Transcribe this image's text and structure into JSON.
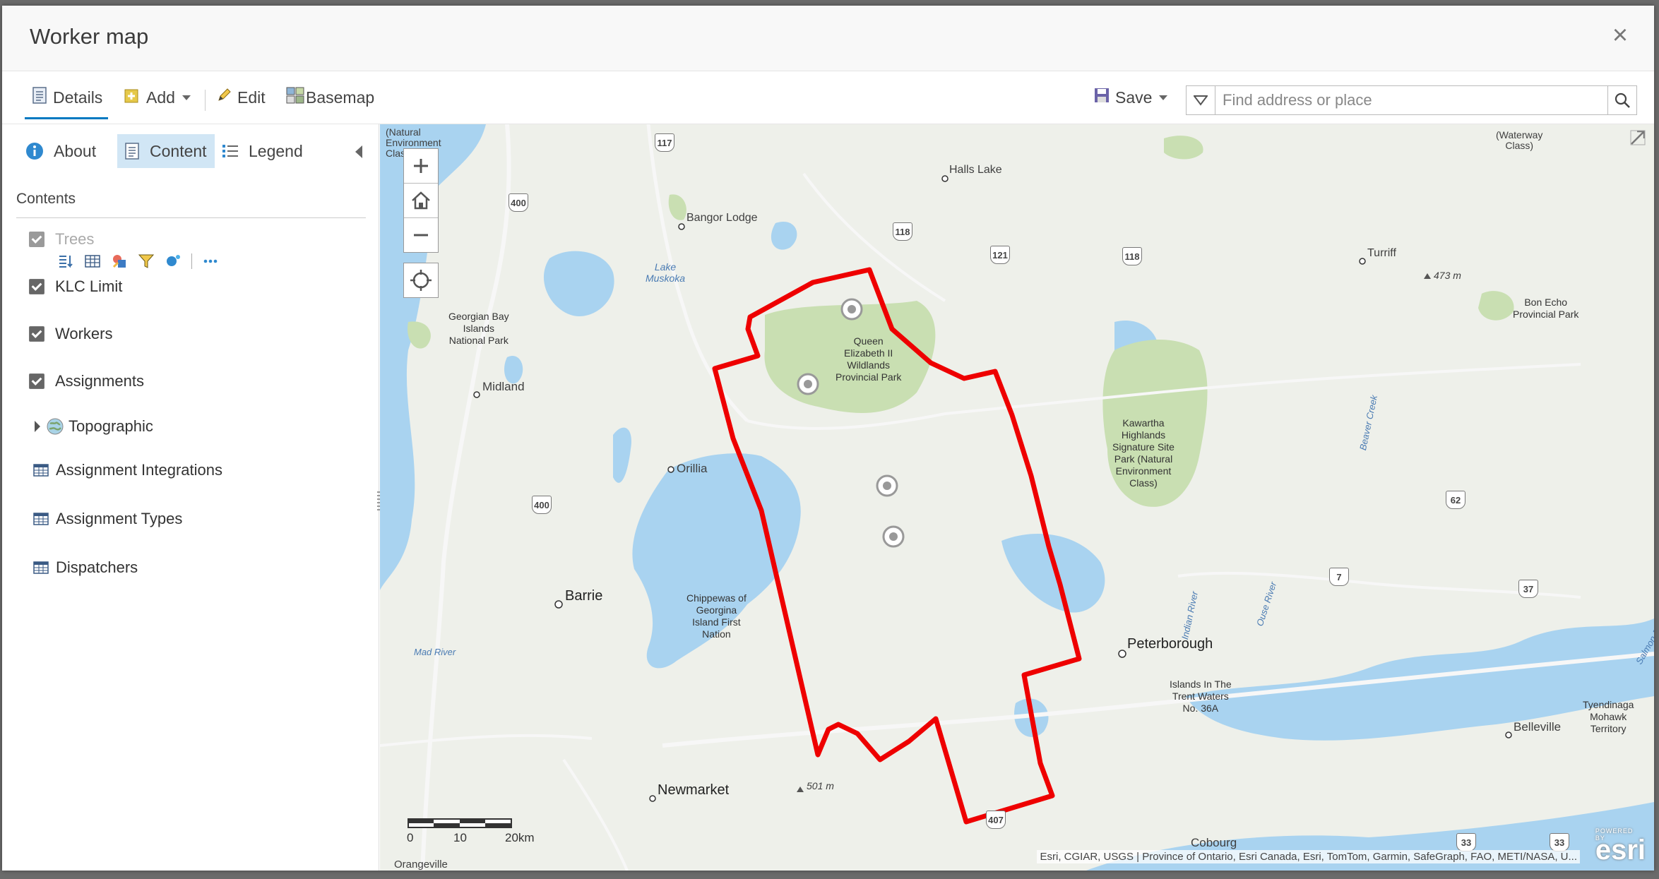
{
  "window": {
    "title": "Worker map",
    "close_icon": "close-icon"
  },
  "toolbar": {
    "details": "Details",
    "add": "Add",
    "edit": "Edit",
    "basemap": "Basemap",
    "save": "Save",
    "search_placeholder": "Find address or place"
  },
  "sidebar": {
    "tabs": {
      "about": "About",
      "content": "Content",
      "legend": "Legend"
    },
    "contents_heading": "Contents",
    "layers": {
      "trees": "Trees",
      "klc": "KLC Limit",
      "workers": "Workers",
      "assignments": "Assignments",
      "topographic": "Topographic",
      "assignment_integrations": "Assignment Integrations",
      "assignment_types": "Assignment Types",
      "dispatchers": "Dispatchers"
    }
  },
  "map": {
    "labels": {
      "natural_env": "(Natural\nEnvironment\nClass)",
      "waterway": "(Waterway\nClass)",
      "halls_lake": "Halls Lake",
      "bangor_lodge": "Bangor Lodge",
      "turriff": "Turriff",
      "elev_473": "473 m",
      "bon_echo": "Bon Echo\nProvincial Park",
      "lake_muskoka": "Lake\nMuskoka",
      "georgian_bay": "Georgian Bay\nIslands\nNational Park",
      "queen_elizabeth": "Queen\nElizabeth II\nWildlands\nProvincial Park",
      "midland": "Midland",
      "kawartha": "Kawartha\nHighlands\nSignature Site\nPark (Natural\nEnvironment\nClass)",
      "beaver_creek": "Beaver Creek",
      "orillia": "Orillia",
      "barrie": "Barrie",
      "chippewas": "Chippewas of\nGeorgina\nIsland First\nNation",
      "indian_river": "Indian River",
      "ouse_river": "Ouse River",
      "peterborough": "Peterborough",
      "islands_trent": "Islands In The\nTrent Waters\nNo. 36A",
      "tyendinaga": "Tyendinaga\nMohawk\nTerritory",
      "belleville": "Belleville",
      "salmon_river": "Salmon River",
      "mad_river": "Mad River",
      "newmarket": "Newmarket",
      "elev_501": "501 m",
      "cobourg": "Cobourg",
      "orangeville": "Orangeville"
    },
    "highways": [
      "117",
      "400",
      "118",
      "121",
      "118",
      "400",
      "62",
      "7",
      "37",
      "407",
      "33",
      "33"
    ],
    "scale": {
      "t0": "0",
      "t1": "10",
      "t2": "20km"
    },
    "attribution": "Esri, CGIAR, USGS | Province of Ontario, Esri Canada, Esri, TomTom, Garmin, SafeGraph, FAO, METI/NASA, U...",
    "esri_powered": "POWERED BY",
    "esri_logo": "esri",
    "boundary_color": "#ee0000",
    "water_color": "#a9d3f0",
    "park_color": "#c9dfb2"
  }
}
